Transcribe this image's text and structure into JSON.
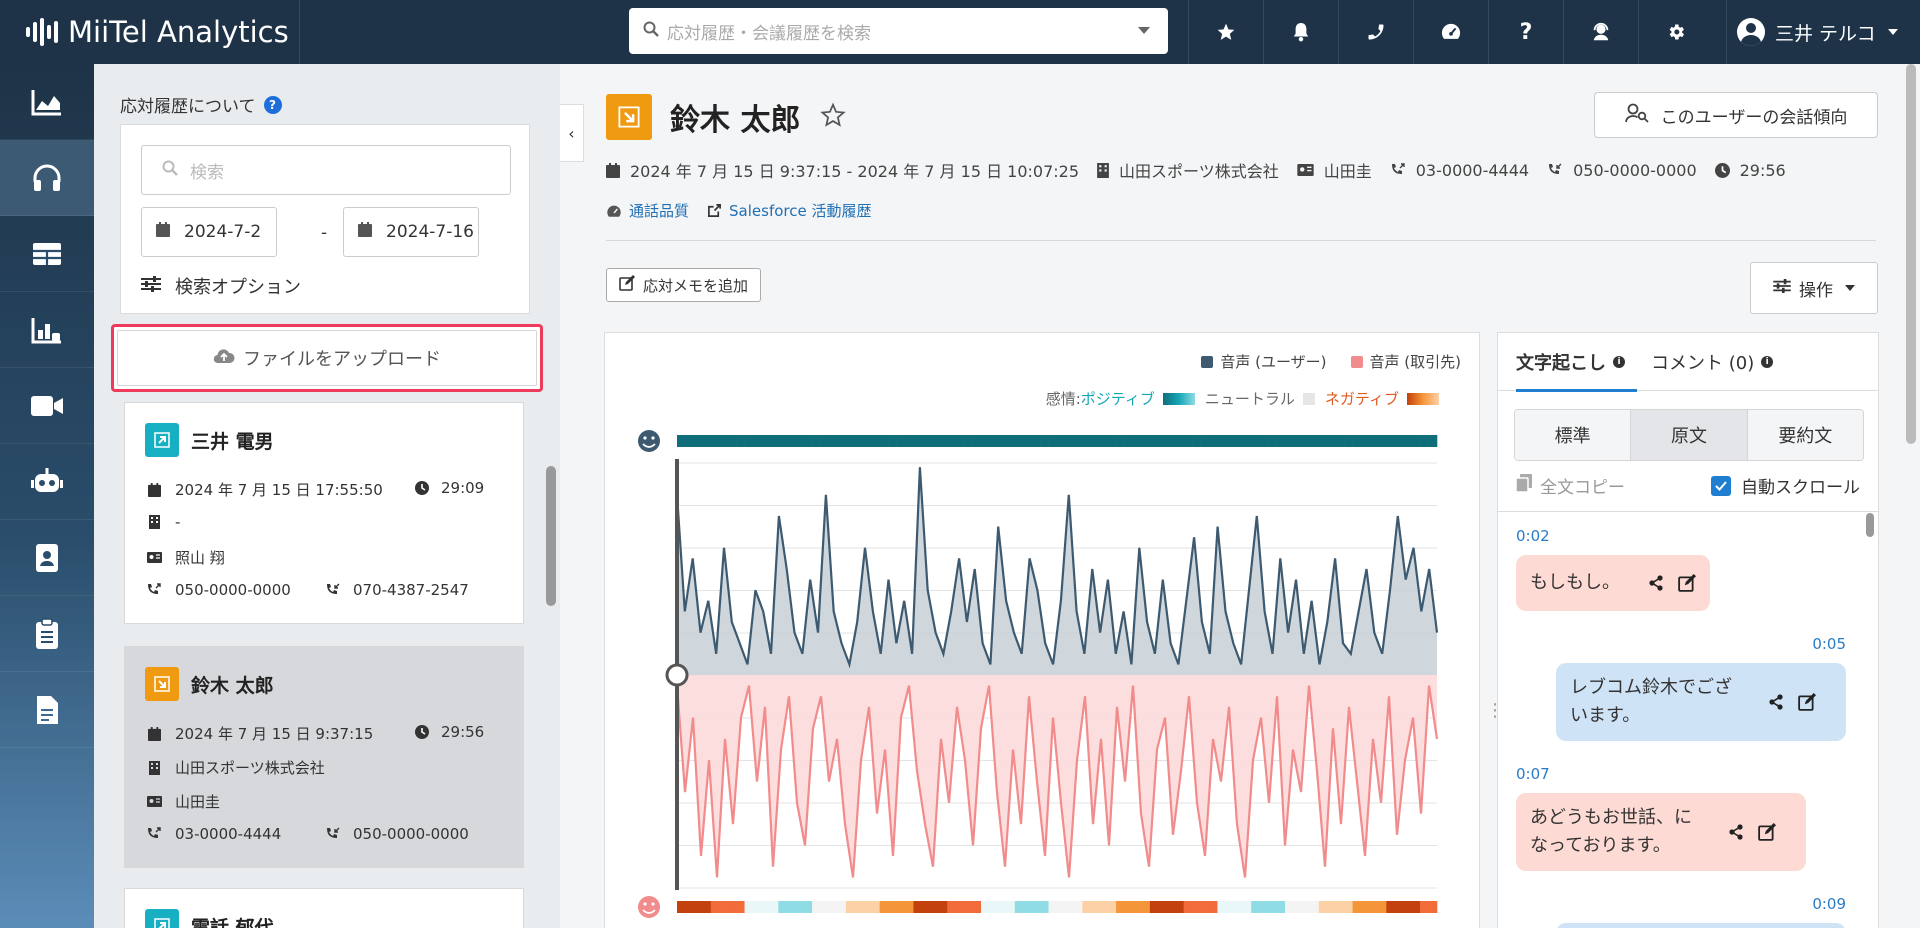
{
  "app": {
    "title": "MiiTel Analytics"
  },
  "topbar": {
    "search_placeholder": "応対履歴・会議履歴を検索",
    "icons": [
      "star-icon",
      "bell-icon",
      "phone-icon",
      "gauge-icon",
      "help-icon",
      "headset-icon",
      "gear-icon"
    ],
    "user_name": "三井 テルコ"
  },
  "leftnav": {
    "items": [
      "analytics-icon",
      "headphones-icon",
      "table-icon",
      "report-icon",
      "video-icon",
      "robot-icon",
      "contacts-icon",
      "clipboard-icon",
      "document-icon"
    ],
    "active_index": 1
  },
  "sidebar": {
    "heading": "応対履歴について",
    "search_placeholder": "検索",
    "date_from": "2024-7-2",
    "date_sep": "-",
    "date_to": "2024-7-16",
    "search_options_label": "検索オプション",
    "upload_label": "ファイルをアップロード",
    "cards": [
      {
        "name": "三井 電男",
        "direction": "outgoing",
        "datetime": "2024 年 7 月 15 日 17:55:50",
        "duration": "29:09",
        "company": "-",
        "contact": "照山 翔",
        "from": "050-0000-0000",
        "to": "070-4387-2547"
      },
      {
        "name": "鈴木 太郎",
        "direction": "incoming",
        "datetime": "2024 年 7 月 15 日 9:37:15",
        "duration": "29:56",
        "company": "山田スポーツ株式会社",
        "contact": "山田圭",
        "from": "03-0000-4444",
        "to": "050-0000-0000"
      },
      {
        "name": "電話 郁代",
        "direction": "outgoing"
      }
    ]
  },
  "detail": {
    "title": "鈴木 太郎",
    "trend_button": "このユーザーの会話傾向",
    "datetime_range": "2024 年 7 月 15 日 9:37:15 - 2024 年 7 月 15 日 10:07:25",
    "company": "山田スポーツ株式会社",
    "contact": "山田圭",
    "phone_from": "03-0000-4444",
    "phone_to": "050-0000-0000",
    "duration": "29:56",
    "link_quality": "通話品質",
    "link_salesforce": "Salesforce 活動履歴",
    "memo_button": "応対メモを追加",
    "ops_button": "操作"
  },
  "chart_data": {
    "type": "area",
    "legend": {
      "user": "音声 (ユーザー)",
      "client": "音声 (取引先)"
    },
    "emotion_legend": {
      "prefix": "感情:",
      "positive": "ポジティブ",
      "neutral": "ニュートラル",
      "negative": "ネガティブ"
    },
    "colors": {
      "user": "#3d5a70",
      "user_fill": "#c7d0d6",
      "client": "#f28b8b",
      "client_fill": "#fddadb",
      "positive": "#16a6b6",
      "negative": "#e8681e"
    },
    "user_series": [
      0.85,
      0.3,
      0.55,
      0.2,
      0.35,
      0.1,
      0.6,
      0.25,
      0.15,
      0.05,
      0.4,
      0.3,
      0.1,
      0.75,
      0.5,
      0.2,
      0.1,
      0.45,
      0.2,
      0.85,
      0.3,
      0.15,
      0.05,
      0.25,
      0.6,
      0.3,
      0.1,
      0.45,
      0.15,
      0.35,
      0.1,
      0.98,
      0.4,
      0.2,
      0.1,
      0.3,
      0.55,
      0.25,
      0.5,
      0.15,
      0.05,
      0.7,
      0.35,
      0.2,
      0.1,
      0.55,
      0.4,
      0.15,
      0.05,
      0.35,
      0.85,
      0.3,
      0.1,
      0.5,
      0.2,
      0.45,
      0.1,
      0.3,
      0.05,
      0.6,
      0.25,
      0.1,
      0.45,
      0.15,
      0.05,
      0.35,
      0.65,
      0.25,
      0.1,
      0.7,
      0.3,
      0.15,
      0.05,
      0.4,
      0.75,
      0.3,
      0.1,
      0.55,
      0.2,
      0.45,
      0.1,
      0.35,
      0.05,
      0.25,
      0.55,
      0.15,
      0.1,
      0.3,
      0.5,
      0.2,
      0.1,
      0.4,
      0.75,
      0.45,
      0.6,
      0.3,
      0.5,
      0.2
    ],
    "client_series": [
      0.05,
      0.55,
      0.2,
      0.85,
      0.4,
      0.95,
      0.3,
      0.7,
      0.2,
      0.05,
      0.5,
      0.15,
      0.9,
      0.35,
      0.1,
      0.6,
      0.8,
      0.25,
      0.1,
      0.5,
      0.3,
      0.7,
      0.95,
      0.4,
      0.15,
      0.65,
      0.35,
      0.85,
      0.2,
      0.05,
      0.45,
      0.7,
      0.9,
      0.3,
      0.6,
      0.15,
      0.4,
      0.8,
      0.25,
      0.05,
      0.55,
      0.9,
      0.35,
      0.7,
      0.1,
      0.5,
      0.85,
      0.2,
      0.6,
      0.95,
      0.4,
      0.1,
      0.7,
      0.3,
      0.8,
      0.15,
      0.5,
      0.05,
      0.65,
      0.9,
      0.35,
      0.2,
      0.75,
      0.45,
      0.1,
      0.6,
      0.85,
      0.3,
      0.5,
      0.15,
      0.7,
      0.95,
      0.4,
      0.2,
      0.6,
      0.1,
      0.8,
      0.35,
      0.55,
      0.05,
      0.45,
      0.9,
      0.25,
      0.7,
      0.15,
      0.5,
      0.85,
      0.3,
      0.6,
      0.1,
      0.75,
      0.4,
      0.2,
      0.65,
      0.05,
      0.3
    ]
  },
  "transcript": {
    "tabs": [
      {
        "label": "文字起こし",
        "active": true
      },
      {
        "label": "コメント (0)",
        "active": false
      }
    ],
    "modes": [
      "標準",
      "原文",
      "要約文"
    ],
    "active_mode": 1,
    "copy_all": "全文コピー",
    "auto_scroll": "自動スクロール",
    "messages": [
      {
        "time": "0:02",
        "speaker": "other",
        "text": "もしもし。"
      },
      {
        "time": "0:05",
        "speaker": "user",
        "text": "レブコム鈴木でございます。"
      },
      {
        "time": "0:07",
        "speaker": "other",
        "text": "あどうもお世話、になっております。"
      },
      {
        "time": "0:09",
        "speaker": "user",
        "text": ""
      }
    ]
  }
}
